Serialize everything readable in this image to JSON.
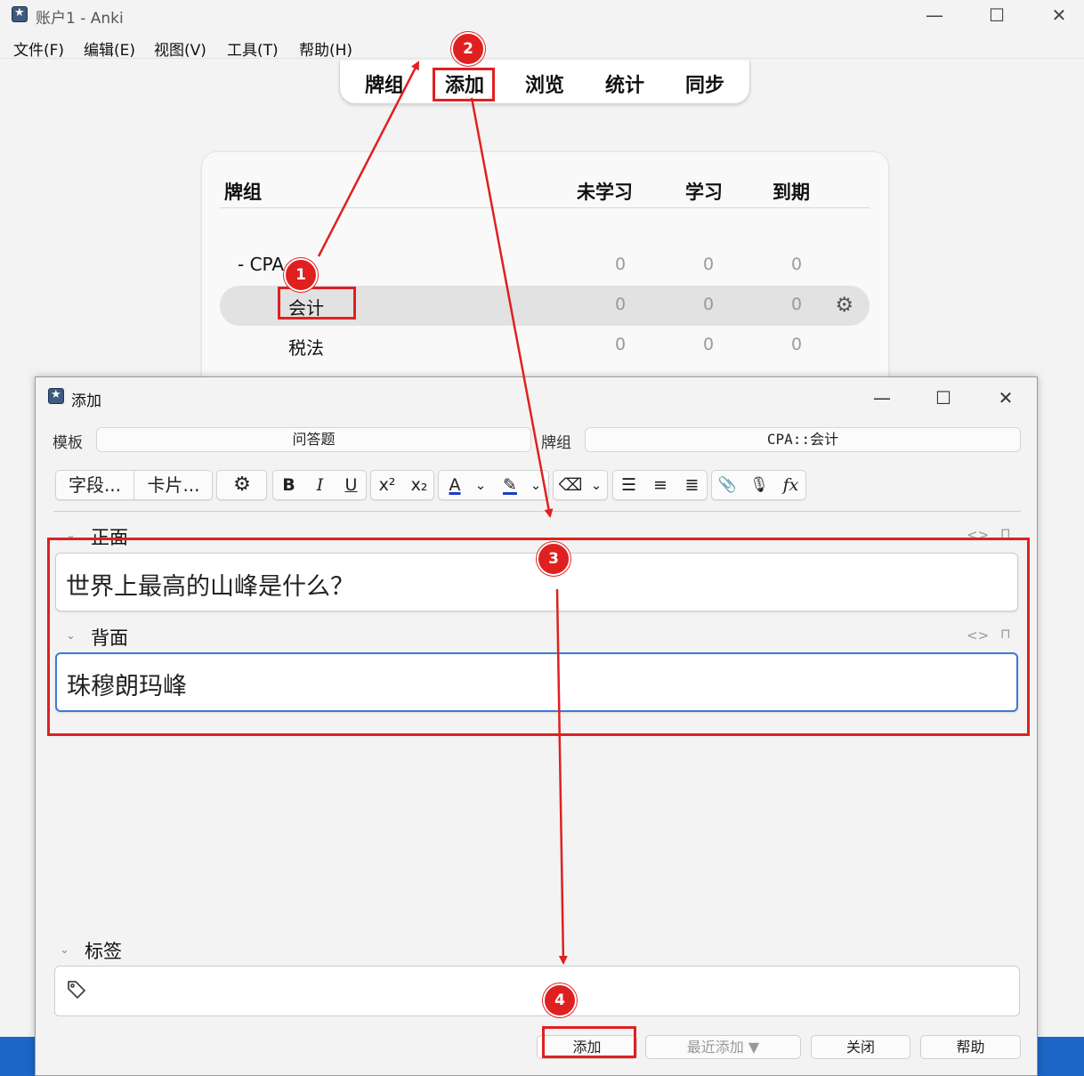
{
  "window": {
    "title": "账户1 - Anki",
    "minimize_glyph": "—",
    "maximize_glyph": "☐",
    "close_glyph": "✕"
  },
  "menu": {
    "items": [
      "文件(F)",
      "编辑(E)",
      "视图(V)",
      "工具(T)",
      "帮助(H)"
    ]
  },
  "top_tabs": [
    "牌组",
    "添加",
    "浏览",
    "统计",
    "同步"
  ],
  "deck_list": {
    "headers": {
      "name": "牌组",
      "new": "未学习",
      "learn": "学习",
      "due": "到期"
    },
    "rows": [
      {
        "name": "-  CPA",
        "new": "0",
        "learn": "0",
        "due": "0"
      },
      {
        "name": "会计",
        "new": "0",
        "learn": "0",
        "due": "0"
      },
      {
        "name": "税法",
        "new": "0",
        "learn": "0",
        "due": "0"
      }
    ],
    "gear_glyph": "⚙"
  },
  "add_dialog": {
    "title": "添加",
    "minimize_glyph": "—",
    "maximize_glyph": "☐",
    "close_glyph": "✕",
    "note_type_label": "模板",
    "note_type_value": "问答题",
    "deck_label": "牌组",
    "deck_value": "CPA::会计",
    "format_bar": {
      "fields_button": "字段...",
      "cards_button": "卡片...",
      "options_glyph": "⚙",
      "bold": "B",
      "italic": "I",
      "underline": "U",
      "superscript": "x²",
      "subscript": "x₂",
      "text_color": "A",
      "dropdown_glyph": "⌄",
      "highlight": "✎",
      "eraser": "⌫",
      "bullet_list": "☰",
      "numbered_list": "≡",
      "align": "≣",
      "attach": "📎",
      "record": "🎙",
      "math": "𝑓x"
    },
    "fields": [
      {
        "label": "正面",
        "value": "世界上最高的山峰是什么？"
      },
      {
        "label": "背面",
        "value": "珠穆朗玛峰"
      }
    ],
    "field_tools": {
      "html": "<>",
      "pin": "⊓"
    },
    "collapse_glyph": "⌄",
    "tags_label": "标签",
    "buttons": {
      "add": "添加",
      "history": "最近添加 ▼",
      "close": "关闭",
      "help": "帮助"
    }
  },
  "annotations": {
    "steps": [
      "1",
      "2",
      "3",
      "4"
    ],
    "color": "#e02020"
  }
}
